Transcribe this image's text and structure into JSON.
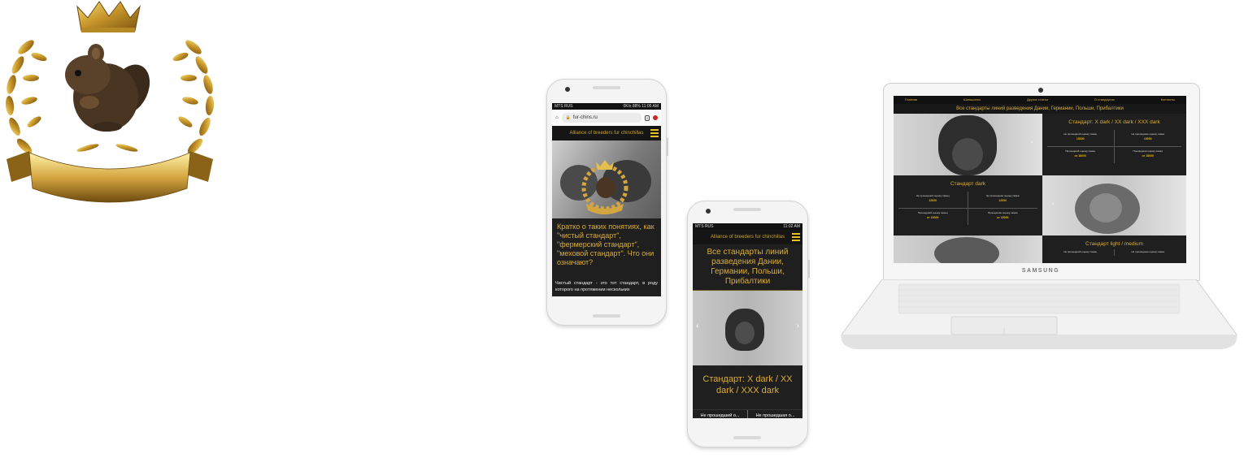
{
  "phone1": {
    "status_left": "MTS RUS",
    "status_right": "0K/s  88%  11:05 AM",
    "url": "fur-chins.ru",
    "site_title": "Alliance of breeders fur chinchillas",
    "heading": "Кратко о таких понятиях, как \"чистый стандарт\", \"фермерский стандарт\", \"меховой стандарт\". Что они означают?",
    "body": "Чистый стандарт - это тот стандарт, в роду которого на протяжении нескольких"
  },
  "phone2": {
    "status_left": "MTS RUS",
    "status_right": "11:02 AM",
    "site_title": "Alliance of breeders fur chinchillas",
    "heading": "Все стандарты линий разведения Дании, Германии, Польши, Прибалтики",
    "section_title": "Стандарт: X dark / XX dark / XXX dark",
    "tab_left": "Не прошедший о...",
    "tab_right": "Не прошедшая о..."
  },
  "laptop": {
    "brand": "SAMSUNG",
    "nav": [
      "Главная",
      "Шиншиллы",
      "Другие статьи",
      "О стандартах",
      "Контакты"
    ],
    "banner": "Все стандарты линий разведения Дании, Германии, Польши, Прибалтики",
    "card1_title": "Стандарт: X dark / XX dark / XXX dark",
    "card2_title": "Стандарт dark",
    "card3_title": "Стандарт light / medium",
    "price_cells": [
      {
        "label": "Не прошедший оценку самец",
        "price": "15000"
      },
      {
        "label": "Не прошедшая оценку самка",
        "price": "15000"
      },
      {
        "label": "Прошедший оценку самец",
        "price": "от 18000"
      },
      {
        "label": "Прошедшая оценку самка",
        "price": "от 18000"
      }
    ],
    "price_cells_dark": [
      {
        "label": "Не прошедший оценку самец",
        "price": "12000"
      },
      {
        "label": "Не прошедшая оценку самка",
        "price": "12000"
      },
      {
        "label": "Прошедший оценку самец",
        "price": "от 15000"
      },
      {
        "label": "Прошедшая оценку самка",
        "price": "от 15000"
      }
    ],
    "price_cells_light": [
      {
        "label": "Не прошедший оценку самец"
      },
      {
        "label": "Не прошедшая оценку самка"
      }
    ]
  },
  "icons": [
    "crown-icon",
    "laurel-wreath-icon",
    "chinchilla-icon",
    "ribbon-banner-icon",
    "home-icon",
    "lock-icon",
    "tabs-icon",
    "menu-icon",
    "arrow-left-icon",
    "arrow-right-icon"
  ],
  "colors": {
    "gold": "#d9ad3c",
    "menu_yellow": "#e6c226",
    "dark_bg": "#1f1f1f"
  }
}
